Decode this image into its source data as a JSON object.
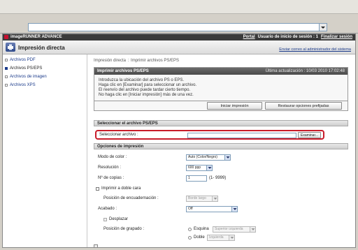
{
  "browser": {
    "address": ""
  },
  "topbar": {
    "brand": "imageRUNNER ADVANCE",
    "portal": "Portal",
    "login_user": "Usuario de inicio de sesión : 1",
    "logout": "Finalizar sesión"
  },
  "header": {
    "title": "Impresión directa",
    "admin_link": "Enviar correo al administrador del sistema"
  },
  "sidebar": {
    "items": [
      {
        "label": "Archivos PDF"
      },
      {
        "label": "Archivos PS/EPS"
      },
      {
        "label": "Archivos de imagen"
      },
      {
        "label": "Archivos XPS"
      }
    ]
  },
  "breadcrumb": {
    "root": "Impresión directa",
    "sep": ":",
    "current": "Imprimir archivos PS/EPS"
  },
  "panel": {
    "title": "Imprimir archivos PS/EPS",
    "updated": "Última actualización : 10/03 2010 17:02:48",
    "lines": [
      "Introduzca la ubicación del archivo PS o EPS.",
      "Haga clic en [Examinar] para seleccionar un archivo.",
      "El reenvío del archivo puede tardar cierto tiempo.",
      "No haga clic en [Iniciar impresión] más de una vez."
    ],
    "start_button": "Iniciar impresión",
    "restore_button": "Restaurar opciones prefijadas"
  },
  "file_section": {
    "title": "Seleccionar el archivo PS/EPS",
    "label": "Seleccionar archivo :",
    "value": "",
    "browse": "Examinar..."
  },
  "options": {
    "title": "Opciones de impresión",
    "color_mode": {
      "label": "Modo de color :",
      "value": "Auto (Color/Negro)"
    },
    "resolution": {
      "label": "Resolución :",
      "value": "600 ppp"
    },
    "copies": {
      "label": "Nº de copias :",
      "value": "1",
      "range": "(1- 9999)"
    },
    "duplex": {
      "label": "Imprimir a doble cara"
    },
    "binding": {
      "label": "Posición de encuadernación :",
      "value": "Borde largo"
    },
    "finishing": {
      "label": "Acabado :",
      "value": "Off"
    },
    "offset": {
      "label": "Desplazar"
    },
    "staple": {
      "label": "Posición de grapado :",
      "corner_label": "Esquina",
      "corner_value": "Superior izquierda",
      "double_label": "Doble",
      "double_value": "Izquierda"
    }
  }
}
